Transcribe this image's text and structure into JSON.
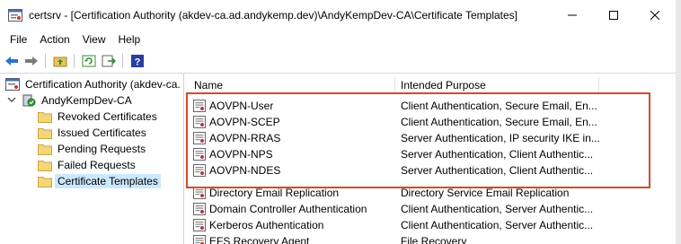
{
  "window": {
    "title": "certsrv - [Certification Authority (akdev-ca.ad.andykemp.dev)\\AndyKempDev-CA\\Certificate Templates]"
  },
  "menu": [
    "File",
    "Action",
    "View",
    "Help"
  ],
  "tree": {
    "root_label": "Certification Authority (akdev-ca.",
    "ca_label": "AndyKempDev-CA",
    "folders": [
      "Revoked Certificates",
      "Issued Certificates",
      "Pending Requests",
      "Failed Requests",
      "Certificate Templates"
    ],
    "selected": "Certificate Templates"
  },
  "list": {
    "columns": [
      "Name",
      "Intended Purpose"
    ],
    "rows": [
      {
        "name": "AOVPN-User",
        "purpose": "Client Authentication, Secure Email, En..."
      },
      {
        "name": "AOVPN-SCEP",
        "purpose": "Client Authentication, Secure Email, En..."
      },
      {
        "name": "AOVPN-RRAS",
        "purpose": "Server Authentication, IP security IKE in..."
      },
      {
        "name": "AOVPN-NPS",
        "purpose": "Server Authentication, Client Authentic..."
      },
      {
        "name": "AOVPN-NDES",
        "purpose": "Server Authentication, Client Authentic..."
      },
      {
        "name": "Directory Email Replication",
        "purpose": "Directory Service Email Replication"
      },
      {
        "name": "Domain Controller Authentication",
        "purpose": "Client Authentication, Server Authentic..."
      },
      {
        "name": "Kerberos Authentication",
        "purpose": "Client Authentication, Server Authentic..."
      },
      {
        "name": "EFS Recovery Agent",
        "purpose": "File Recovery"
      }
    ]
  },
  "colors": {
    "highlight": "#d44a2a",
    "selection": "#cce8ff"
  }
}
